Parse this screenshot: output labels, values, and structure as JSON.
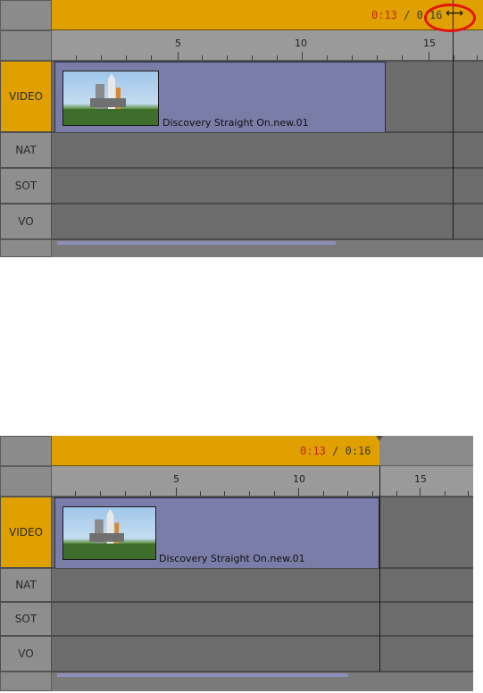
{
  "panels": [
    {
      "time_current": "0:13",
      "time_separator": "/",
      "time_total": "0:16",
      "ruler": {
        "labels": [
          "5",
          "10",
          "15"
        ]
      },
      "tracks": {
        "video": "VIDEO",
        "nat": "NAT",
        "sot": "SOT",
        "vo": "VO"
      },
      "clip": {
        "name": "Discovery Straight On.new.01"
      },
      "cursor_icon": "resize-horizontal-icon",
      "highlight_color": "#e3140f"
    },
    {
      "time_current": "0:13",
      "time_separator": "/",
      "time_total": "0:16",
      "ruler": {
        "labels": [
          "5",
          "10",
          "15"
        ]
      },
      "tracks": {
        "video": "VIDEO",
        "nat": "NAT",
        "sot": "SOT",
        "vo": "VO"
      },
      "clip": {
        "name": "Discovery Straight On.new.01"
      }
    }
  ],
  "colors": {
    "accent": "#e0a100",
    "clip": "#7b7da9",
    "track": "#6c6c6c",
    "current_time": "#c0261a"
  }
}
